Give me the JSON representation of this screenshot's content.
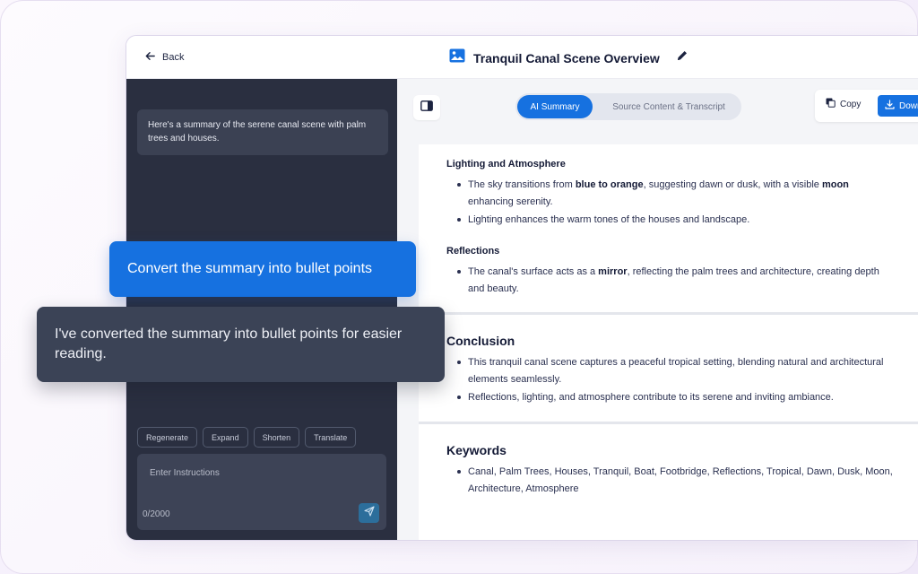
{
  "topbar": {
    "back_label": "Back",
    "title": "Tranquil Canal Scene Overview"
  },
  "chat": {
    "first_message": "Here's a summary of the serene canal scene with palm trees and houses.",
    "user_bubble": "Convert the summary into bullet points",
    "ai_bubble": "I've converted the summary into bullet points for easier reading.",
    "chips": [
      "Regenerate",
      "Expand",
      "Shorten",
      "Translate"
    ],
    "input_placeholder": "Enter Instructions",
    "char_count": "0/2000"
  },
  "tabs": {
    "active": "AI Summary",
    "inactive": "Source Content & Transcript"
  },
  "actions": {
    "copy_label": "Copy",
    "download_label": "Download"
  },
  "doc": {
    "lighting": {
      "heading": "Lighting and Atmosphere",
      "b1_pre": "The sky transitions from ",
      "b1_bold1": "blue to orange",
      "b1_mid": ", suggesting dawn or dusk, with a visible ",
      "b1_bold2": "moon",
      "b1_post": " enhancing serenity.",
      "b2": "Lighting enhances the warm tones of the houses and landscape."
    },
    "reflections": {
      "heading": "Reflections",
      "b1_pre": "The canal's surface acts as a ",
      "b1_bold": "mirror",
      "b1_post": ", reflecting the palm trees and architecture, creating depth and beauty."
    },
    "conclusion": {
      "heading": "Conclusion",
      "b1": "This tranquil canal scene captures a peaceful tropical setting, blending natural and architectural elements seamlessly.",
      "b2": "Reflections, lighting, and atmosphere contribute to its serene and inviting ambiance."
    },
    "keywords": {
      "heading": "Keywords",
      "b1": "Canal, Palm Trees, Houses, Tranquil, Boat, Footbridge, Reflections, Tropical, Dawn, Dusk, Moon, Architecture, Atmosphere"
    }
  },
  "colors": {
    "accent": "#1671e0",
    "panel_dark": "#2a2f40",
    "bubble_dark": "#3b4356"
  }
}
